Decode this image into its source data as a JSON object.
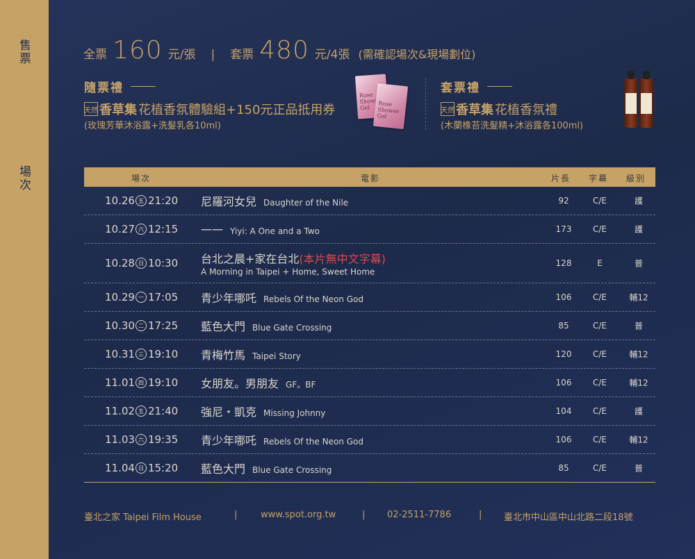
{
  "side": {
    "tickets": "售票",
    "sessions": "場次"
  },
  "price": {
    "single_label": "全票",
    "single_price": "160",
    "single_unit": "元/張",
    "sep": "|",
    "set_label": "套票",
    "set_price": "480",
    "set_unit": "元/4張",
    "note": "(需確認場次&現場劃位)"
  },
  "gift_ticket": {
    "title": "隨票禮",
    "brand_mark": "天然",
    "brand": "香草集",
    "line": "花植香氛體驗組+150元正品抵用券",
    "sub": "(玫瑰芳華沐浴露+洗髮乳各10ml)",
    "pack_text": "Rose Shower Gel"
  },
  "gift_set": {
    "title": "套票禮",
    "brand_mark": "天然",
    "brand": "香草集",
    "line": "花植香氛禮",
    "sub": "(木蘭橡苔洗髮精+沐浴露各100ml)"
  },
  "table": {
    "headers": {
      "session": "場次",
      "film": "電影",
      "length": "片長",
      "subtitle": "字幕",
      "rating": "級別"
    },
    "rows": [
      {
        "date": "10.26",
        "day": "五",
        "time": "21:20",
        "zh": "尼羅河女兒",
        "en": "Daughter of the Nile",
        "length": "92",
        "sub": "C/E",
        "rating": "護"
      },
      {
        "date": "10.27",
        "day": "六",
        "time": "12:15",
        "zh": "一一",
        "en": "Yiyi: A One and a Two",
        "length": "173",
        "sub": "C/E",
        "rating": "護"
      },
      {
        "date": "10.28",
        "day": "日",
        "time": "10:30",
        "zh": "台北之晨+家在台北",
        "note": "(本片無中文字幕)",
        "en": "A Morning in Taipei + Home, Sweet Home",
        "length": "128",
        "sub": "E",
        "rating": "普"
      },
      {
        "date": "10.29",
        "day": "一",
        "time": "17:05",
        "zh": "青少年哪吒",
        "en": "Rebels Of the Neon God",
        "length": "106",
        "sub": "C/E",
        "rating": "輔12"
      },
      {
        "date": "10.30",
        "day": "二",
        "time": "17:25",
        "zh": "藍色大門",
        "en": "Blue Gate Crossing",
        "length": "85",
        "sub": "C/E",
        "rating": "普"
      },
      {
        "date": "10.31",
        "day": "三",
        "time": "19:10",
        "zh": "青梅竹馬",
        "en": "Taipei Story",
        "length": "120",
        "sub": "C/E",
        "rating": "輔12"
      },
      {
        "date": "11.01",
        "day": "四",
        "time": "19:10",
        "zh": "女朋友。男朋友",
        "en": "GF。BF",
        "length": "106",
        "sub": "C/E",
        "rating": "輔12"
      },
      {
        "date": "11.02",
        "day": "五",
        "time": "21:40",
        "zh": "強尼・凱克",
        "en": "Missing Johnny",
        "length": "104",
        "sub": "C/E",
        "rating": "護"
      },
      {
        "date": "11.03",
        "day": "六",
        "time": "19:35",
        "zh": "青少年哪吒",
        "en": "Rebels Of the Neon God",
        "length": "106",
        "sub": "C/E",
        "rating": "輔12"
      },
      {
        "date": "11.04",
        "day": "日",
        "time": "15:20",
        "zh": "藍色大門",
        "en": "Blue Gate Crossing",
        "length": "85",
        "sub": "C/E",
        "rating": "普"
      }
    ]
  },
  "footer": {
    "venue": "臺北之家 Taipei Film House",
    "sep": "|",
    "website": "www.spot.org.tw",
    "phone": "02-2511-7786",
    "address": "臺北市中山區中山北路二段18號"
  },
  "colors": {
    "navy": "#1f2c4c",
    "gold": "#c6a266",
    "text": "#d9d6cc",
    "red": "#d94a4a"
  }
}
